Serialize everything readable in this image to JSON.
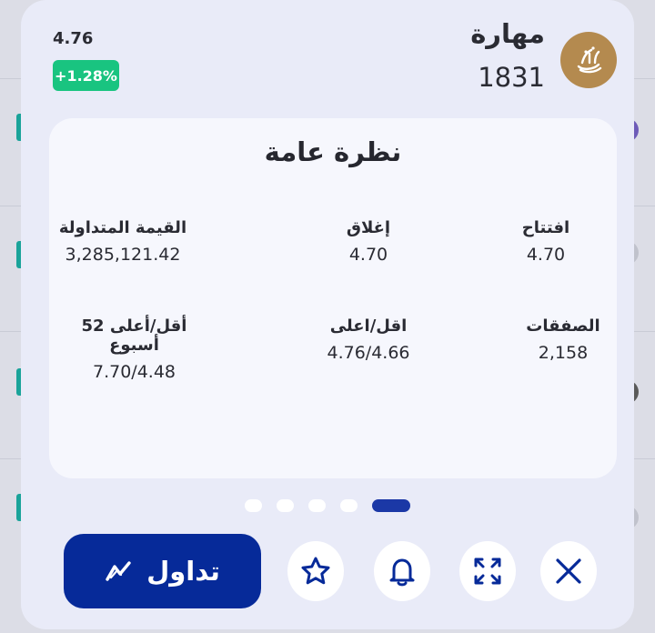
{
  "company": {
    "name": "مهارة",
    "code": "1831"
  },
  "quote": {
    "price": "4.76",
    "change": "+1.28%"
  },
  "overview": {
    "title": "نظرة عامة",
    "stats": [
      {
        "label": "افتتاح",
        "value": "4.70"
      },
      {
        "label": "إغلاق",
        "value": "4.70"
      },
      {
        "label": "القيمة المتداولة",
        "value": "3,285,121.42"
      },
      {
        "label": "الصفقات",
        "value": "2,158"
      },
      {
        "label": "اقل/اعلى",
        "value": "4.76/4.66"
      },
      {
        "label": "أقل/أعلى 52 أسبوع",
        "value": "7.70/4.48"
      }
    ]
  },
  "pagination": {
    "count": 5,
    "active_index": 4
  },
  "actions": {
    "trade_label": "تداول",
    "icons": [
      "close-icon",
      "expand-icon",
      "bell-icon",
      "star-icon",
      "trade-icon"
    ]
  },
  "colors": {
    "primary": "#062a99",
    "positive": "#19c480",
    "logo": "#b48a4f",
    "sheet": "#e9ebf8"
  }
}
